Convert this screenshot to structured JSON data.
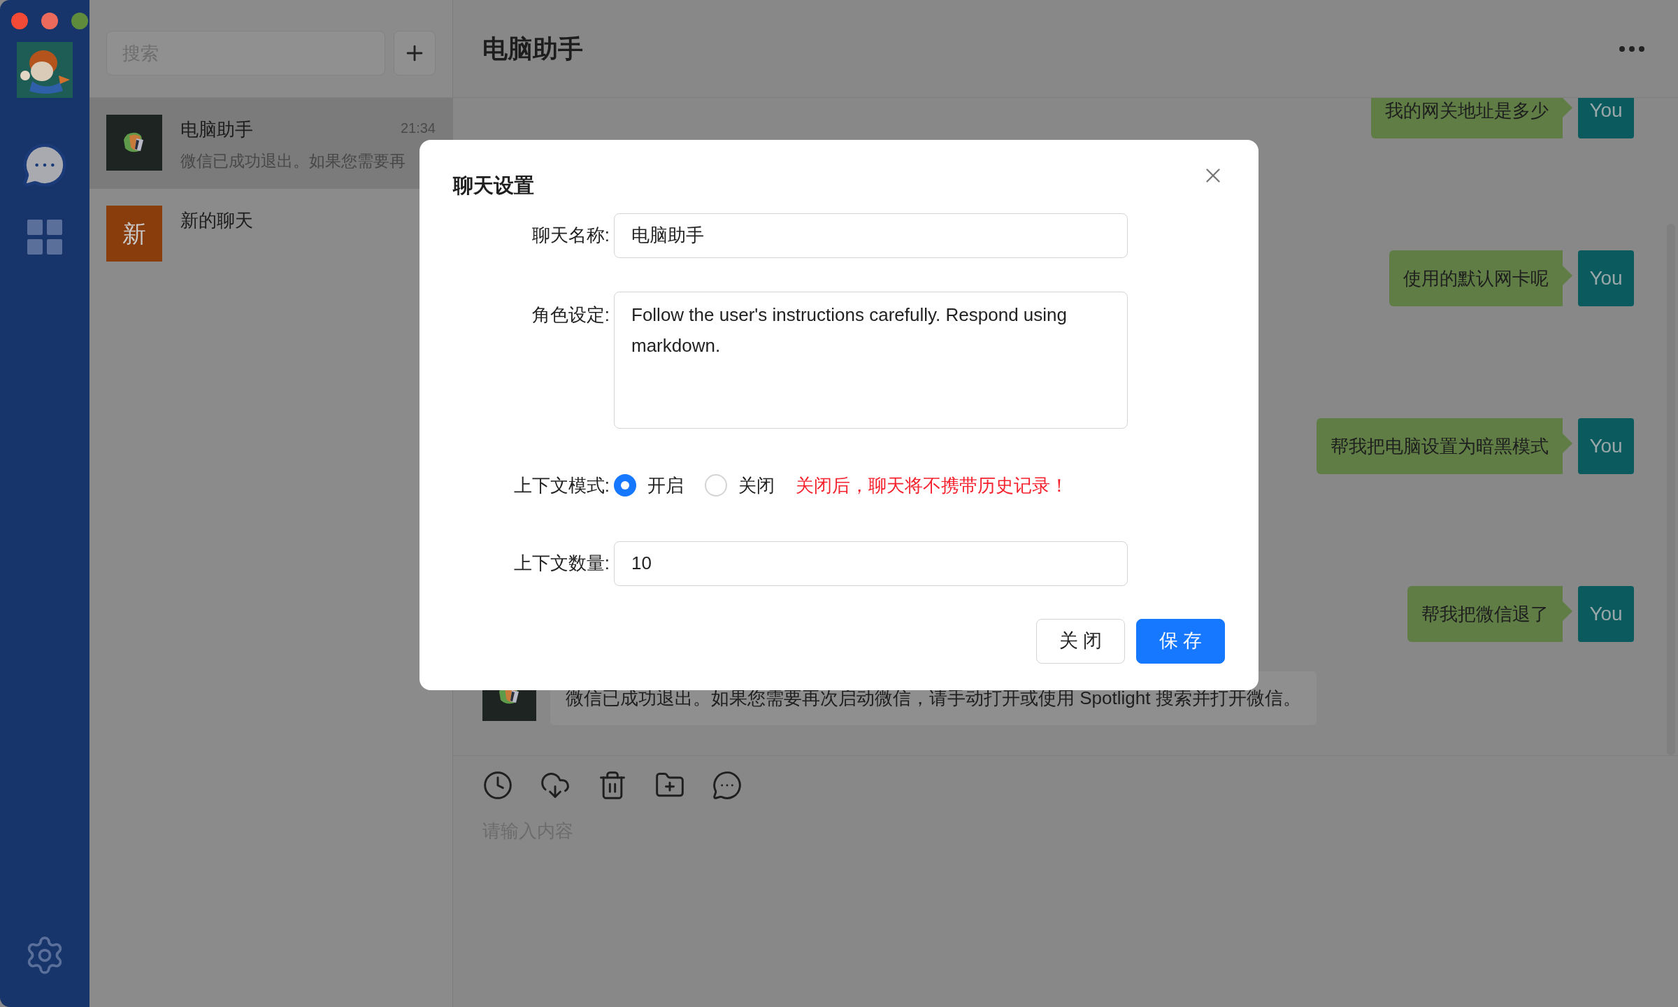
{
  "chat_list": {
    "search": {
      "placeholder": "搜索"
    },
    "items": [
      {
        "name": "电脑助手",
        "time": "21:34",
        "preview": "微信已成功退出。如果您需要再",
        "avatar": {
          "kind": "logo"
        },
        "selected": true
      },
      {
        "name": "新的聊天",
        "avatar": {
          "kind": "text",
          "text": "新"
        },
        "selected": false
      }
    ]
  },
  "chat": {
    "title": "电脑助手",
    "messages": [
      {
        "kind": "user",
        "text": "我的网关地址是多少",
        "avatar_label": "You"
      },
      {
        "kind": "user",
        "text": "使用的默认网卡呢",
        "avatar_label": "You"
      },
      {
        "kind": "user",
        "text": "帮我把电脑设置为暗黑模式",
        "avatar_label": "You"
      },
      {
        "kind": "user",
        "text": "帮我把微信退了",
        "avatar_label": "You"
      },
      {
        "kind": "assistant",
        "text": "微信已成功退出。如果您需要再次启动微信，请手动打开或使用 Spotlight 搜索并打开微信。"
      }
    ],
    "input": {
      "placeholder": "请输入内容"
    }
  },
  "dialog": {
    "title": "聊天设置",
    "name": {
      "label": "聊天名称:",
      "value": "电脑助手"
    },
    "role": {
      "label": "角色设定:",
      "value": "Follow the user's instructions carefully. Respond using markdown."
    },
    "context_mode": {
      "label": "上下文模式:",
      "options": [
        {
          "label": "开启",
          "selected": true
        },
        {
          "label": "关闭",
          "selected": false
        }
      ],
      "warning": "关闭后，聊天将不携带历史记录！"
    },
    "context_count": {
      "label": "上下文数量:",
      "value": "10"
    },
    "buttons": [
      {
        "label": "关 闭",
        "kind": "secondary"
      },
      {
        "label": "保 存",
        "kind": "primary"
      }
    ]
  }
}
